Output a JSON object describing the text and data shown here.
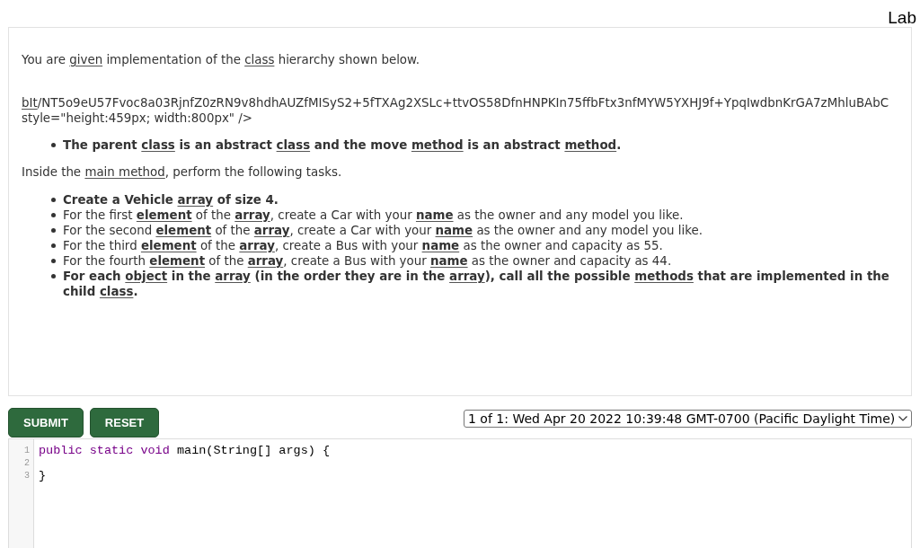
{
  "header": {
    "title": "Lab"
  },
  "question": {
    "blocks": [
      {
        "kind": "paragraph",
        "lines": [
          [
            {
              "text": "You are ",
              "link": false,
              "bold": false
            },
            {
              "text": "given",
              "link": true,
              "bold": false
            },
            {
              "text": " implementation of the ",
              "link": false,
              "bold": false
            },
            {
              "text": "class",
              "link": true,
              "bold": false
            },
            {
              "text": " hierarchy shown below.",
              "link": false,
              "bold": false
            }
          ]
        ]
      },
      {
        "kind": "paragraph",
        "lines": [
          [
            {
              "text": "bIt",
              "link": true,
              "bold": false
            },
            {
              "text": "/NT5o9eU57Fvoc8a03RjnfZ0zRN9v8hdhAUZfMISyS2+5fTXAg2XSLc+ttvOS58DfnHNPKIn75ffbFtx3nfMYW5YXHJ9f+YpqIwdbnKrGA7zMhluBAbC",
              "link": false,
              "bold": false
            }
          ],
          [
            {
              "text": "style=\"height:459px; width:800px\" />",
              "link": false,
              "bold": false
            }
          ]
        ]
      },
      {
        "kind": "list",
        "items": [
          {
            "segments": [
              {
                "text": "The parent ",
                "link": false,
                "bold": true
              },
              {
                "text": "class",
                "link": true,
                "bold": true
              },
              {
                "text": " is an abstract ",
                "link": false,
                "bold": true
              },
              {
                "text": "class",
                "link": true,
                "bold": true
              },
              {
                "text": " and the move ",
                "link": false,
                "bold": true
              },
              {
                "text": "method",
                "link": true,
                "bold": true
              },
              {
                "text": " is an abstract ",
                "link": false,
                "bold": true
              },
              {
                "text": "method",
                "link": true,
                "bold": true
              },
              {
                "text": ".",
                "link": false,
                "bold": true
              }
            ]
          }
        ]
      },
      {
        "kind": "paragraph",
        "lines": [
          [
            {
              "text": "Inside the ",
              "link": false,
              "bold": false
            },
            {
              "text": "main method",
              "link": true,
              "bold": false
            },
            {
              "text": ", perform the following tasks.",
              "link": false,
              "bold": false
            }
          ]
        ]
      },
      {
        "kind": "list",
        "items": [
          {
            "segments": [
              {
                "text": "Create a Vehicle ",
                "link": false,
                "bold": true
              },
              {
                "text": "array",
                "link": true,
                "bold": true
              },
              {
                "text": " of size 4.",
                "link": false,
                "bold": true
              }
            ]
          },
          {
            "segments": [
              {
                "text": "For the first ",
                "link": false,
                "bold": false
              },
              {
                "text": "element",
                "link": true,
                "bold": true
              },
              {
                "text": " of the ",
                "link": false,
                "bold": false
              },
              {
                "text": "array",
                "link": true,
                "bold": true
              },
              {
                "text": ", create a Car with your ",
                "link": false,
                "bold": false
              },
              {
                "text": "name",
                "link": true,
                "bold": true
              },
              {
                "text": " as the owner and any model you like.",
                "link": false,
                "bold": false
              }
            ]
          },
          {
            "segments": [
              {
                "text": "For the second ",
                "link": false,
                "bold": false
              },
              {
                "text": "element",
                "link": true,
                "bold": true
              },
              {
                "text": " of the ",
                "link": false,
                "bold": false
              },
              {
                "text": "array",
                "link": true,
                "bold": true
              },
              {
                "text": ", create a Car with your ",
                "link": false,
                "bold": false
              },
              {
                "text": "name",
                "link": true,
                "bold": true
              },
              {
                "text": " as the owner and any model you like.",
                "link": false,
                "bold": false
              }
            ]
          },
          {
            "segments": [
              {
                "text": "For the third ",
                "link": false,
                "bold": false
              },
              {
                "text": "element",
                "link": true,
                "bold": true
              },
              {
                "text": " of the ",
                "link": false,
                "bold": false
              },
              {
                "text": "array",
                "link": true,
                "bold": true
              },
              {
                "text": ", create a Bus with your ",
                "link": false,
                "bold": false
              },
              {
                "text": "name",
                "link": true,
                "bold": true
              },
              {
                "text": " as the owner and capacity as 55.",
                "link": false,
                "bold": false
              }
            ]
          },
          {
            "segments": [
              {
                "text": "For the fourth ",
                "link": false,
                "bold": false
              },
              {
                "text": "element",
                "link": true,
                "bold": true
              },
              {
                "text": " of the ",
                "link": false,
                "bold": false
              },
              {
                "text": "array",
                "link": true,
                "bold": true
              },
              {
                "text": ", create a Bus with your ",
                "link": false,
                "bold": false
              },
              {
                "text": "name",
                "link": true,
                "bold": true
              },
              {
                "text": " as the owner and capacity as 44.",
                "link": false,
                "bold": false
              }
            ]
          },
          {
            "segments": [
              {
                "text": "For each ",
                "link": false,
                "bold": true
              },
              {
                "text": "object",
                "link": true,
                "bold": true
              },
              {
                "text": " in the ",
                "link": false,
                "bold": true
              },
              {
                "text": "array",
                "link": true,
                "bold": true
              },
              {
                "text": " (in the order they are in the ",
                "link": false,
                "bold": true
              },
              {
                "text": "array",
                "link": true,
                "bold": true
              },
              {
                "text": "), call all the possible ",
                "link": false,
                "bold": true
              },
              {
                "text": "methods",
                "link": true,
                "bold": true
              },
              {
                "text": " that are implemented in the child ",
                "link": false,
                "bold": true
              },
              {
                "text": "class",
                "link": true,
                "bold": true
              },
              {
                "text": ".",
                "link": false,
                "bold": true
              }
            ]
          }
        ]
      }
    ]
  },
  "buttons": [
    {
      "label": "SUBMIT"
    },
    {
      "label": "RESET"
    }
  ],
  "version_select": {
    "value": "1 of 1: Wed Apr 20 2022 10:39:48 GMT-0700 (Pacific Daylight Time)"
  },
  "editor": {
    "lines": [
      {
        "number": "1",
        "tokens": [
          {
            "text": "public static void",
            "kind": "keyword"
          },
          {
            "text": " main(String[] args) {",
            "kind": "plain"
          }
        ]
      },
      {
        "number": "2"
      },
      {
        "number": "3",
        "tokens": [
          {
            "text": "}",
            "kind": "plain"
          }
        ]
      }
    ]
  }
}
